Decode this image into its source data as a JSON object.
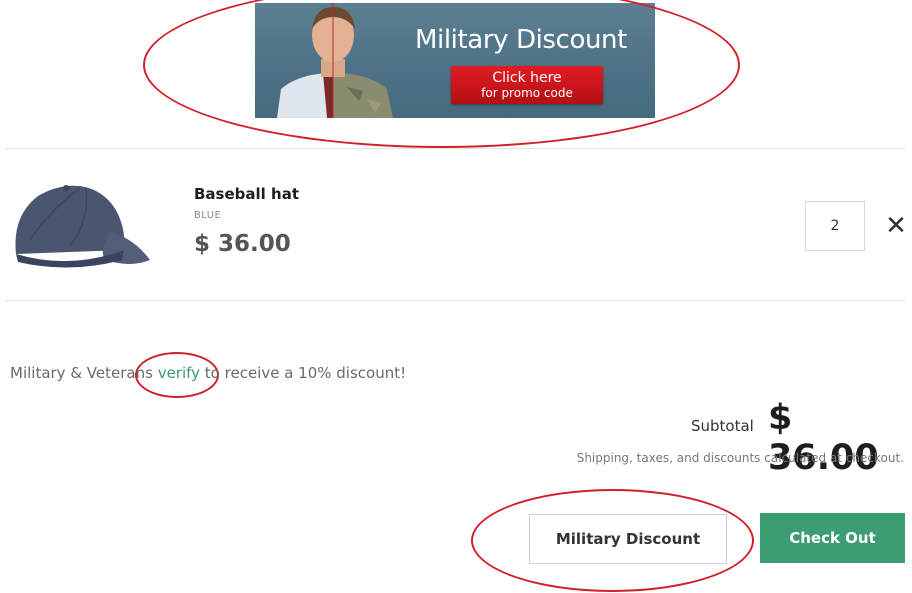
{
  "banner": {
    "headline": "Military Discount",
    "promo_line1": "Click here",
    "promo_line2": "for promo code"
  },
  "cart_item": {
    "name": "Baseball hat",
    "variant": "BLUE",
    "price": "$ 36.00",
    "quantity": "2",
    "remove_icon": "close-icon"
  },
  "veteran_notice": {
    "prefix": "Military & Veterans ",
    "link": "verify",
    "suffix": " to receive a 10% discount!"
  },
  "summary": {
    "subtotal_label": "Subtotal",
    "subtotal_value": "$ 36.00",
    "shipping_note": "Shipping, taxes, and discounts calculated at checkout."
  },
  "buttons": {
    "military_discount": "Military Discount",
    "checkout": "Check Out"
  },
  "colors": {
    "accent_green": "#3c9d72",
    "annotation_red": "#d0202a",
    "promo_red": "#e21c23"
  }
}
